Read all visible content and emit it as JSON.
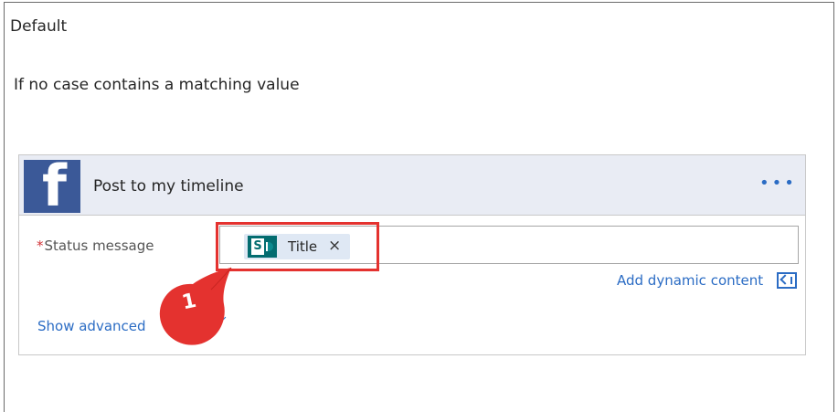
{
  "branch": {
    "title": "Default",
    "description": "If no case contains a matching value"
  },
  "action": {
    "connector_icon": "facebook-icon",
    "title": "Post to my timeline",
    "more_label": "•••",
    "field": {
      "required_mark": "*",
      "label": "Status message",
      "token": {
        "icon": "sharepoint-icon",
        "label": "Title",
        "remove_label": "×"
      }
    },
    "dynamic_content_label": "Add dynamic content",
    "show_advanced_label": "Show advanced"
  },
  "annotation": {
    "step_number": "1",
    "color": "#e4322f"
  },
  "colors": {
    "facebook": "#3b5998",
    "link": "#2b6cc4",
    "header_bg": "#e9ecf4",
    "sharepoint": "#036c70"
  }
}
